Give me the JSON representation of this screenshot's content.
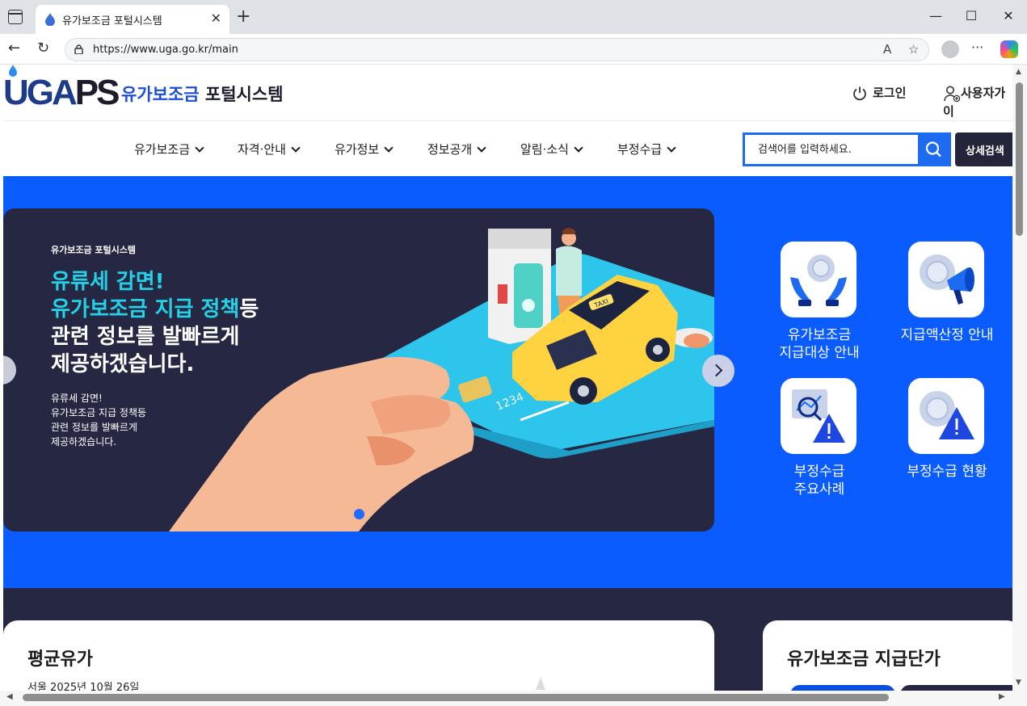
{
  "browser": {
    "tab_title": "유가보조금 포털시스템",
    "url": "https://www.uga.go.kr/main"
  },
  "header": {
    "logo_mark_a": "UGA",
    "logo_mark_b": "PS",
    "logo_text_a": "유가보조금",
    "logo_text_b": " 포털시스템",
    "login": "로그인",
    "user_guide": "사용자가이"
  },
  "gnb": {
    "items": [
      "유가보조금",
      "자격·안내",
      "유가정보",
      "정보공개",
      "알림·소식",
      "부정수급"
    ],
    "search_placeholder": "검색어를 입력하세요.",
    "advanced_search": "상세검색"
  },
  "slide": {
    "kicker": "유가보조금 포털시스템",
    "head_line1": "유류세 감면!",
    "head_line2_a": "유가보조금 지급 정책",
    "head_line2_b": "등",
    "head_line3": "관련 정보를 발빠르게",
    "head_line4": "제공하겠습니다.",
    "body_line1": "유류세 감면!",
    "body_line2": "유가보조금 지급 정책등",
    "body_line3": "관련 정보를 발빠르게",
    "body_line4": "제공하겠습니다.",
    "taxi_sign": "TAXI",
    "card_text": "1234"
  },
  "quick_links": [
    {
      "line1": "유가보조금",
      "line2": "지급대상 안내",
      "icon": "hands-coin-icon"
    },
    {
      "line1": "지급액산정 안내",
      "line2": "",
      "icon": "megaphone-coin-icon"
    },
    {
      "line1": "부정수급",
      "line2": "주요사례",
      "icon": "chart-warning-icon"
    },
    {
      "line1": "부정수급 현황",
      "line2": "",
      "icon": "coin-warning-icon"
    }
  ],
  "panels": {
    "avg_price_title": "평균유가",
    "avg_price_date": "서울 2025년 10월 26일",
    "unit_price_title": "유가보조금 지급단가"
  },
  "colors": {
    "primary": "#0a5cff",
    "navy": "#262742",
    "accent_cyan": "#24d1e6"
  }
}
